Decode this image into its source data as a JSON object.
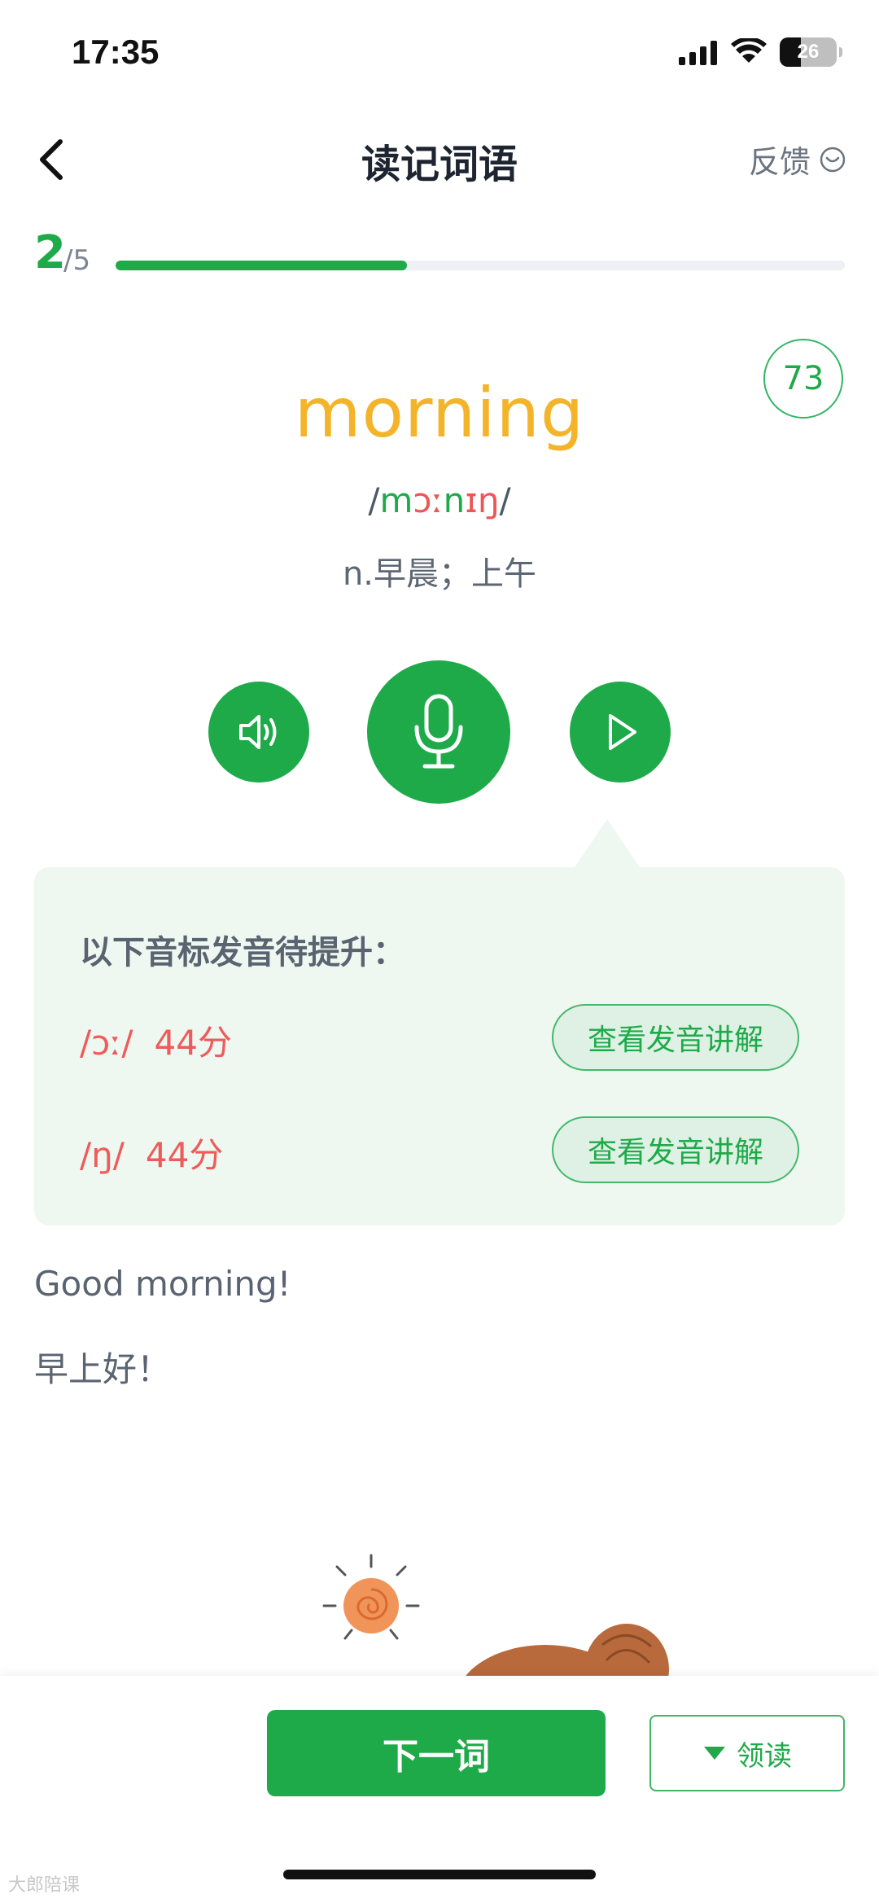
{
  "status_bar": {
    "time": "17:35",
    "battery": "26"
  },
  "header": {
    "title": "读记词语",
    "feedback_label": "反馈"
  },
  "progress": {
    "current": "2",
    "total": "/5",
    "fraction": 0.4
  },
  "word_card": {
    "score": "73",
    "word": "morning",
    "phonetic": {
      "open": "/",
      "part1": "m",
      "part2": "ɔː",
      "part3": "n",
      "part4": "ɪŋ",
      "close": "/"
    },
    "meaning": "n.早晨；上午"
  },
  "actions": {
    "audio_icon": "speaker-icon",
    "record_icon": "microphone-icon",
    "play_icon": "play-icon"
  },
  "feedback_panel": {
    "title": "以下音标发音待提升：",
    "items": [
      {
        "phoneme": "/ɔː/",
        "score": "44分",
        "button": "查看发音讲解"
      },
      {
        "phoneme": "/ŋ/",
        "score": "44分",
        "button": "查看发音讲解"
      }
    ]
  },
  "example": {
    "en": "Good morning!",
    "cn": "早上好！"
  },
  "bottom_bar": {
    "next_label": "下一词",
    "lead_label": "领读"
  },
  "watermark": "大郎陪课",
  "colors": {
    "accent": "#1faa4a",
    "word": "#f4b42a",
    "warning": "#ef5555"
  }
}
